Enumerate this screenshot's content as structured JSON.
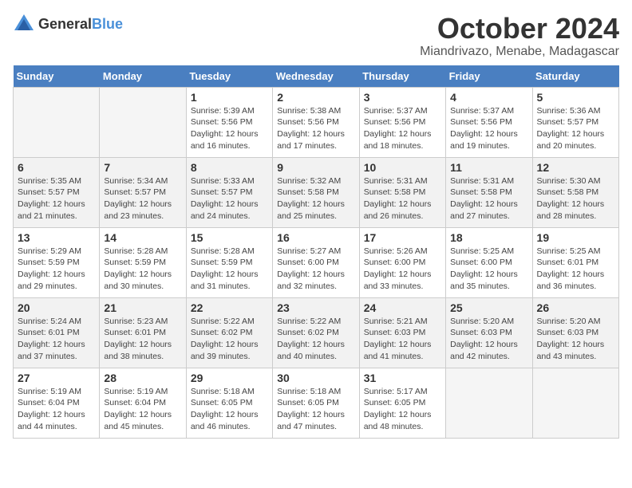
{
  "header": {
    "logo": {
      "general": "General",
      "blue": "Blue"
    },
    "month": "October 2024",
    "location": "Miandrivazo, Menabe, Madagascar"
  },
  "weekdays": [
    "Sunday",
    "Monday",
    "Tuesday",
    "Wednesday",
    "Thursday",
    "Friday",
    "Saturday"
  ],
  "weeks": [
    [
      {
        "day": null
      },
      {
        "day": null
      },
      {
        "day": 1,
        "sunrise": "5:39 AM",
        "sunset": "5:56 PM",
        "daylight": "12 hours and 16 minutes."
      },
      {
        "day": 2,
        "sunrise": "5:38 AM",
        "sunset": "5:56 PM",
        "daylight": "12 hours and 17 minutes."
      },
      {
        "day": 3,
        "sunrise": "5:37 AM",
        "sunset": "5:56 PM",
        "daylight": "12 hours and 18 minutes."
      },
      {
        "day": 4,
        "sunrise": "5:37 AM",
        "sunset": "5:56 PM",
        "daylight": "12 hours and 19 minutes."
      },
      {
        "day": 5,
        "sunrise": "5:36 AM",
        "sunset": "5:57 PM",
        "daylight": "12 hours and 20 minutes."
      }
    ],
    [
      {
        "day": 6,
        "sunrise": "5:35 AM",
        "sunset": "5:57 PM",
        "daylight": "12 hours and 21 minutes."
      },
      {
        "day": 7,
        "sunrise": "5:34 AM",
        "sunset": "5:57 PM",
        "daylight": "12 hours and 23 minutes."
      },
      {
        "day": 8,
        "sunrise": "5:33 AM",
        "sunset": "5:57 PM",
        "daylight": "12 hours and 24 minutes."
      },
      {
        "day": 9,
        "sunrise": "5:32 AM",
        "sunset": "5:58 PM",
        "daylight": "12 hours and 25 minutes."
      },
      {
        "day": 10,
        "sunrise": "5:31 AM",
        "sunset": "5:58 PM",
        "daylight": "12 hours and 26 minutes."
      },
      {
        "day": 11,
        "sunrise": "5:31 AM",
        "sunset": "5:58 PM",
        "daylight": "12 hours and 27 minutes."
      },
      {
        "day": 12,
        "sunrise": "5:30 AM",
        "sunset": "5:58 PM",
        "daylight": "12 hours and 28 minutes."
      }
    ],
    [
      {
        "day": 13,
        "sunrise": "5:29 AM",
        "sunset": "5:59 PM",
        "daylight": "12 hours and 29 minutes."
      },
      {
        "day": 14,
        "sunrise": "5:28 AM",
        "sunset": "5:59 PM",
        "daylight": "12 hours and 30 minutes."
      },
      {
        "day": 15,
        "sunrise": "5:28 AM",
        "sunset": "5:59 PM",
        "daylight": "12 hours and 31 minutes."
      },
      {
        "day": 16,
        "sunrise": "5:27 AM",
        "sunset": "6:00 PM",
        "daylight": "12 hours and 32 minutes."
      },
      {
        "day": 17,
        "sunrise": "5:26 AM",
        "sunset": "6:00 PM",
        "daylight": "12 hours and 33 minutes."
      },
      {
        "day": 18,
        "sunrise": "5:25 AM",
        "sunset": "6:00 PM",
        "daylight": "12 hours and 35 minutes."
      },
      {
        "day": 19,
        "sunrise": "5:25 AM",
        "sunset": "6:01 PM",
        "daylight": "12 hours and 36 minutes."
      }
    ],
    [
      {
        "day": 20,
        "sunrise": "5:24 AM",
        "sunset": "6:01 PM",
        "daylight": "12 hours and 37 minutes."
      },
      {
        "day": 21,
        "sunrise": "5:23 AM",
        "sunset": "6:01 PM",
        "daylight": "12 hours and 38 minutes."
      },
      {
        "day": 22,
        "sunrise": "5:22 AM",
        "sunset": "6:02 PM",
        "daylight": "12 hours and 39 minutes."
      },
      {
        "day": 23,
        "sunrise": "5:22 AM",
        "sunset": "6:02 PM",
        "daylight": "12 hours and 40 minutes."
      },
      {
        "day": 24,
        "sunrise": "5:21 AM",
        "sunset": "6:03 PM",
        "daylight": "12 hours and 41 minutes."
      },
      {
        "day": 25,
        "sunrise": "5:20 AM",
        "sunset": "6:03 PM",
        "daylight": "12 hours and 42 minutes."
      },
      {
        "day": 26,
        "sunrise": "5:20 AM",
        "sunset": "6:03 PM",
        "daylight": "12 hours and 43 minutes."
      }
    ],
    [
      {
        "day": 27,
        "sunrise": "5:19 AM",
        "sunset": "6:04 PM",
        "daylight": "12 hours and 44 minutes."
      },
      {
        "day": 28,
        "sunrise": "5:19 AM",
        "sunset": "6:04 PM",
        "daylight": "12 hours and 45 minutes."
      },
      {
        "day": 29,
        "sunrise": "5:18 AM",
        "sunset": "6:05 PM",
        "daylight": "12 hours and 46 minutes."
      },
      {
        "day": 30,
        "sunrise": "5:18 AM",
        "sunset": "6:05 PM",
        "daylight": "12 hours and 47 minutes."
      },
      {
        "day": 31,
        "sunrise": "5:17 AM",
        "sunset": "6:05 PM",
        "daylight": "12 hours and 48 minutes."
      },
      {
        "day": null
      },
      {
        "day": null
      }
    ]
  ],
  "labels": {
    "sunrise": "Sunrise:",
    "sunset": "Sunset:",
    "daylight": "Daylight:"
  }
}
